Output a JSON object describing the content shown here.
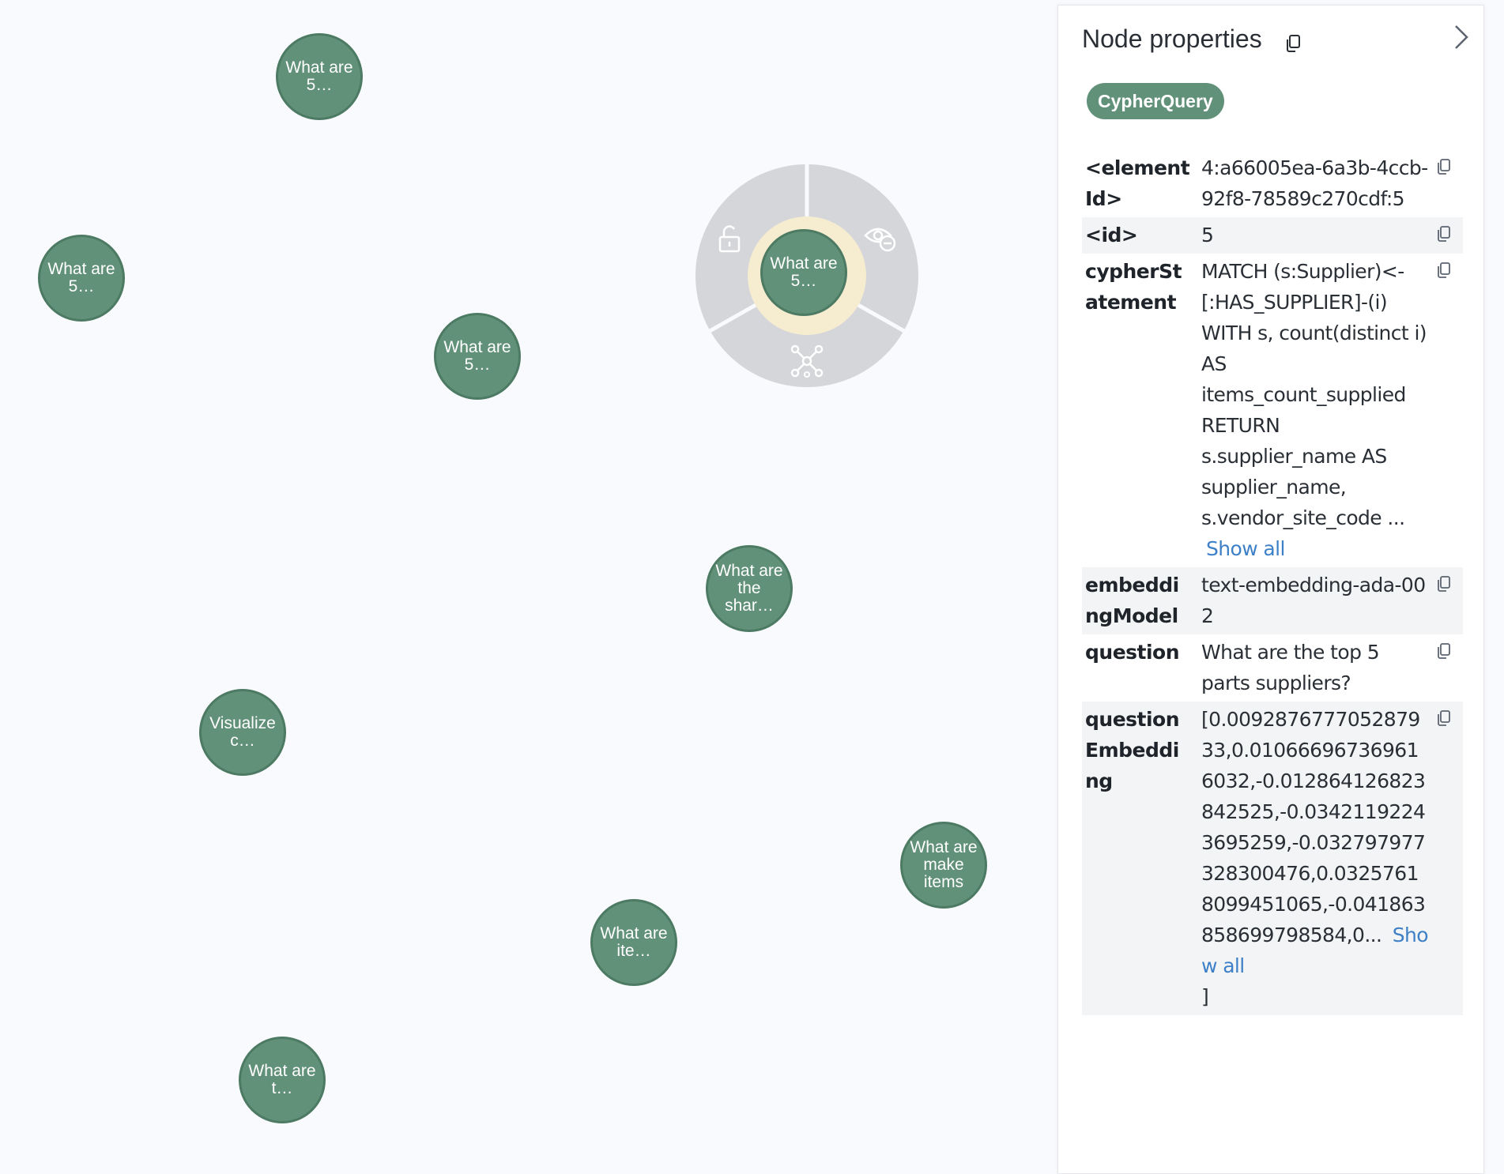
{
  "graph": {
    "nodes": [
      {
        "id": "n1",
        "caption": "What are\n5…"
      },
      {
        "id": "n2",
        "caption": "What are\n5…"
      },
      {
        "id": "n3",
        "caption": "What are\n5…"
      },
      {
        "id": "n4",
        "caption": "What are\n5…"
      },
      {
        "id": "n5",
        "caption": "What are\nthe\nshar…"
      },
      {
        "id": "n6",
        "caption": "Visualize\nc…"
      },
      {
        "id": "n7",
        "caption": "What are\nmake\nitems"
      },
      {
        "id": "n8",
        "caption": "What are\nite…"
      },
      {
        "id": "n9",
        "caption": "What are\nt…"
      }
    ],
    "context_menu": {
      "actions": [
        "unlock-icon",
        "hide-eye-icon",
        "expand-graph-icon"
      ]
    }
  },
  "panel": {
    "title": "Node properties",
    "label_chip": "CypherQuery",
    "show_all_label": "Show all",
    "properties": [
      {
        "key": "<elementId>",
        "value": "4:a66005ea-6a3b-4ccb-92f8-78589c270cdf:5"
      },
      {
        "key": "<id>",
        "value": "5"
      },
      {
        "key": "cypherStatement",
        "value": "MATCH (s:Supplier)<-[:HAS_SUPPLIER]-(i) WITH s, count(distinct i) AS items_count_supplied RETURN s.supplier_name AS supplier_name, s.vendor_site_code ..."
      },
      {
        "key": "embeddingModel",
        "value": "text-embedding-ada-002"
      },
      {
        "key": "question",
        "value": "What are the top 5 parts suppliers?"
      },
      {
        "key": "questionEmbedding",
        "value": "[0.009287677705287933,0.010666967369616032,-0.012864126823842525,-0.03421192243695259,-0.032797977328300476,0.03257618099451065,-0.041863858699798584,0...",
        "suffix": "]"
      }
    ]
  },
  "colors": {
    "node_fill": "#62917a",
    "node_border": "#4c7a63",
    "link": "#3d80c7",
    "halo": "#f6ecd0",
    "ring": "#d5d6da"
  }
}
